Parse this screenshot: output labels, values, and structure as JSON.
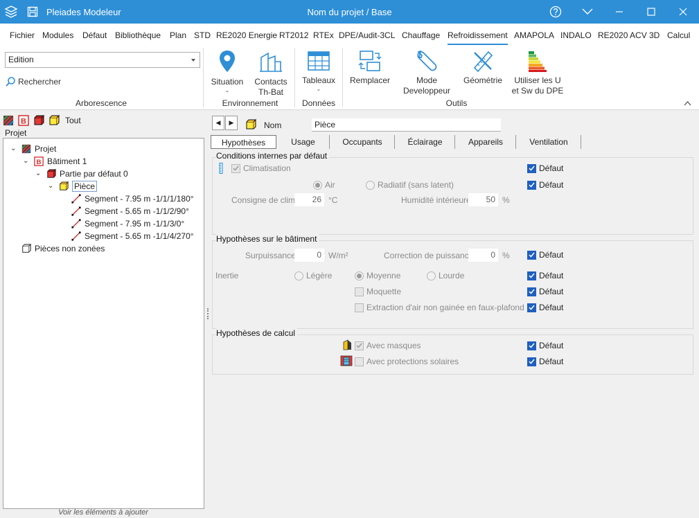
{
  "app": {
    "name": "Pleiades Modeleur",
    "document_title": "Nom du projet / Base"
  },
  "menu": [
    "Fichier",
    "Modules",
    "Défaut",
    "Bibliothèque",
    "Plan",
    "STD",
    "RE2020 Energie",
    "RT2012",
    "RTEx",
    "DPE/Audit-3CL",
    "Chauffage",
    "Refroidissement",
    "AMAPOLA",
    "INDALO",
    "RE2020 ACV",
    "3D",
    "Calcul"
  ],
  "menu_active": "Refroidissement",
  "ribbon": {
    "combo_value": "Edition",
    "search_label": "Rechercher",
    "groups": {
      "arborescence": "Arborescence",
      "environnement": "Environnement",
      "donnees": "Données",
      "outils": "Outils"
    },
    "buttons": {
      "situation": "Situation",
      "contacts_1": "Contacts",
      "contacts_2": "Th-Bat",
      "tableaux": "Tableaux",
      "remplacer": "Remplacer",
      "mode_1": "Mode",
      "mode_2": "Developpeur",
      "geometrie": "Géométrie",
      "utiliser_1": "Utiliser les U",
      "utiliser_2": "et Sw du DPE"
    }
  },
  "left": {
    "tout_label": "Tout",
    "tree_title": "Projet",
    "tree": [
      {
        "label": "Projet"
      },
      {
        "label": "Bâtiment 1"
      },
      {
        "label": "Partie par défaut 0"
      },
      {
        "label": "Pièce"
      },
      {
        "label": "Segment - 7.95 m -1/1/1/180°"
      },
      {
        "label": "Segment - 5.65 m -1/1/2/90°"
      },
      {
        "label": "Segment - 7.95 m -1/1/3/0°"
      },
      {
        "label": "Segment - 5.65 m -1/1/4/270°"
      },
      {
        "label": "Pièces non zonées"
      }
    ],
    "footer": "Voir les éléments à ajouter"
  },
  "right": {
    "nom_label": "Nom",
    "nom_value": "Pièce",
    "tabs": [
      "Hypothèses",
      "Usage",
      "Occupants",
      "Éclairage",
      "Appareils",
      "Ventilation"
    ],
    "active_tab": "Hypothèses",
    "defaut_label": "Défaut",
    "g1": {
      "title": "Conditions internes par défaut",
      "climatisation": "Climatisation",
      "air": "Air",
      "radiatif": "Radiatif (sans latent)",
      "consigne_label": "Consigne de clim.",
      "consigne_value": "26",
      "consigne_unit": "°C",
      "humidite_label": "Humidité intérieure",
      "humidite_value": "50",
      "humidite_unit": "%"
    },
    "g2": {
      "title": "Hypothèses sur le bâtiment",
      "surpuissance_label": "Surpuissance",
      "surpuissance_value": "0",
      "surpuissance_unit": "W/m²",
      "correction_label": "Correction de puissance",
      "correction_value": "0",
      "correction_unit": "%",
      "inertie_label": "Inertie",
      "legere": "Légère",
      "moyenne": "Moyenne",
      "lourde": "Lourde",
      "moquette": "Moquette",
      "extraction": "Extraction d'air non gainée en faux-plafond"
    },
    "g3": {
      "title": "Hypothèses de calcul",
      "masques": "Avec masques",
      "protections": "Avec protections solaires"
    }
  },
  "colors": {
    "titlebar": "#2e8fd6",
    "accent": "#1f5fbf"
  }
}
